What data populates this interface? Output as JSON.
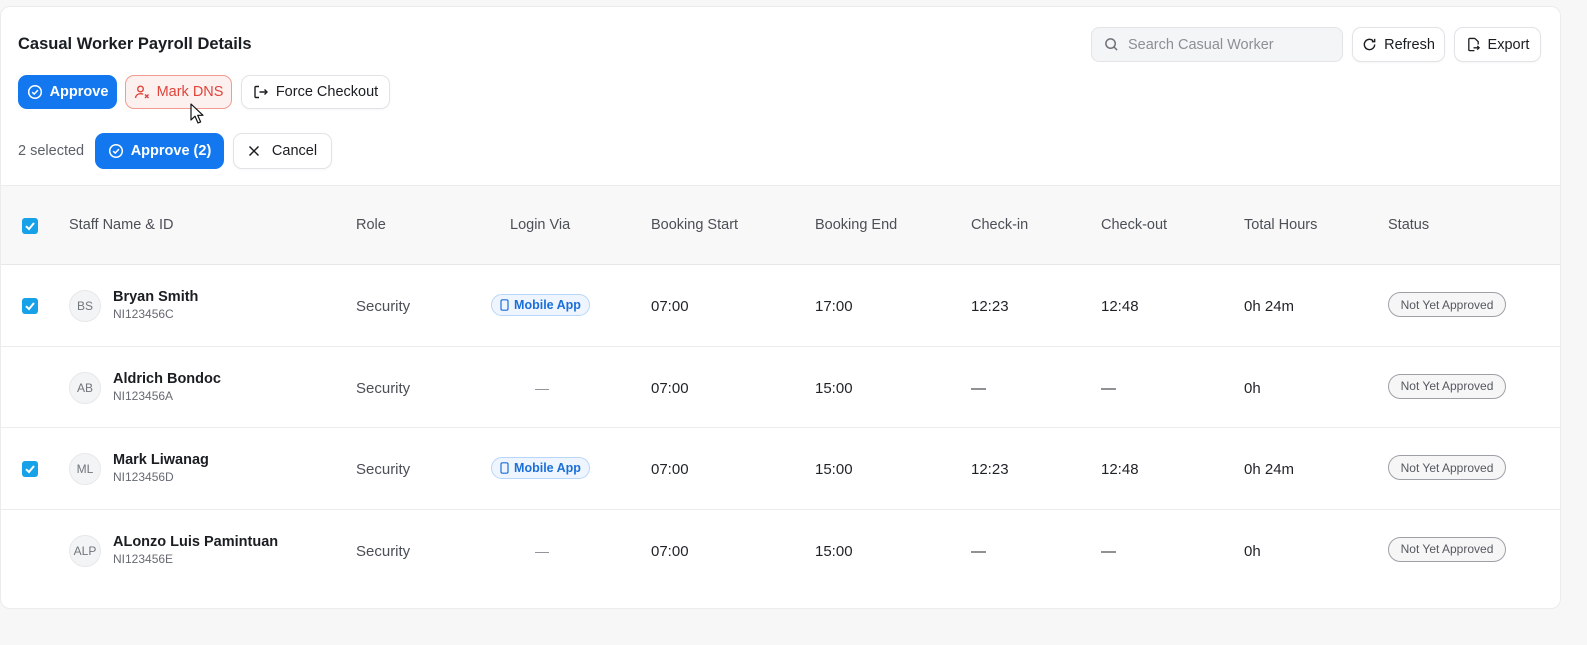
{
  "header": {
    "title": "Casual Worker Payroll Details",
    "search_placeholder": "Search Casual Worker",
    "refresh_label": "Refresh",
    "export_label": "Export"
  },
  "actions": {
    "approve_label": "Approve",
    "mark_dns_label": "Mark DNS",
    "force_checkout_label": "Force Checkout"
  },
  "selection": {
    "selected_text": "2 selected",
    "approve_selected_label": "Approve (2)",
    "cancel_label": "Cancel"
  },
  "table": {
    "columns": [
      "Staff Name & ID",
      "Role",
      "Login Via",
      "Booking Start",
      "Booking End",
      "Check-in",
      "Check-out",
      "Total Hours",
      "Status"
    ],
    "rows": [
      {
        "checked": true,
        "initials": "BS",
        "name": "Bryan Smith",
        "id": "NI123456C",
        "role": "Security",
        "login_via": "Mobile App",
        "booking_start": "07:00",
        "booking_end": "17:00",
        "check_in": "12:23",
        "check_out": "12:48",
        "total_hours": "0h 24m",
        "status": "Not Yet Approved"
      },
      {
        "checked": false,
        "initials": "AB",
        "name": "Aldrich Bondoc",
        "id": "NI123456A",
        "role": "Security",
        "login_via": "—",
        "booking_start": "07:00",
        "booking_end": "15:00",
        "check_in": "—",
        "check_out": "—",
        "total_hours": "0h",
        "status": "Not Yet Approved"
      },
      {
        "checked": true,
        "initials": "ML",
        "name": "Mark Liwanag",
        "id": "NI123456D",
        "role": "Security",
        "login_via": "Mobile App",
        "booking_start": "07:00",
        "booking_end": "15:00",
        "check_in": "12:23",
        "check_out": "12:48",
        "total_hours": "0h 24m",
        "status": "Not Yet Approved"
      },
      {
        "checked": false,
        "initials": "ALP",
        "name": "ALonzo Luis Pamintuan",
        "id": "NI123456E",
        "role": "Security",
        "login_via": "—",
        "booking_start": "07:00",
        "booking_end": "15:00",
        "check_in": "—",
        "check_out": "—",
        "total_hours": "0h",
        "status": "Not Yet Approved"
      }
    ]
  },
  "colors": {
    "primary": "#1378f0",
    "checkbox": "#16a1e8",
    "danger": "#e0443a",
    "pill": "#1b6fd8"
  },
  "icons": {
    "search": "search-icon",
    "refresh": "refresh-icon",
    "export": "export-icon",
    "approve": "check-circle-icon",
    "mark_dns": "user-x-icon",
    "force_checkout": "logout-icon",
    "cancel": "close-icon",
    "mobile": "mobile-icon"
  }
}
